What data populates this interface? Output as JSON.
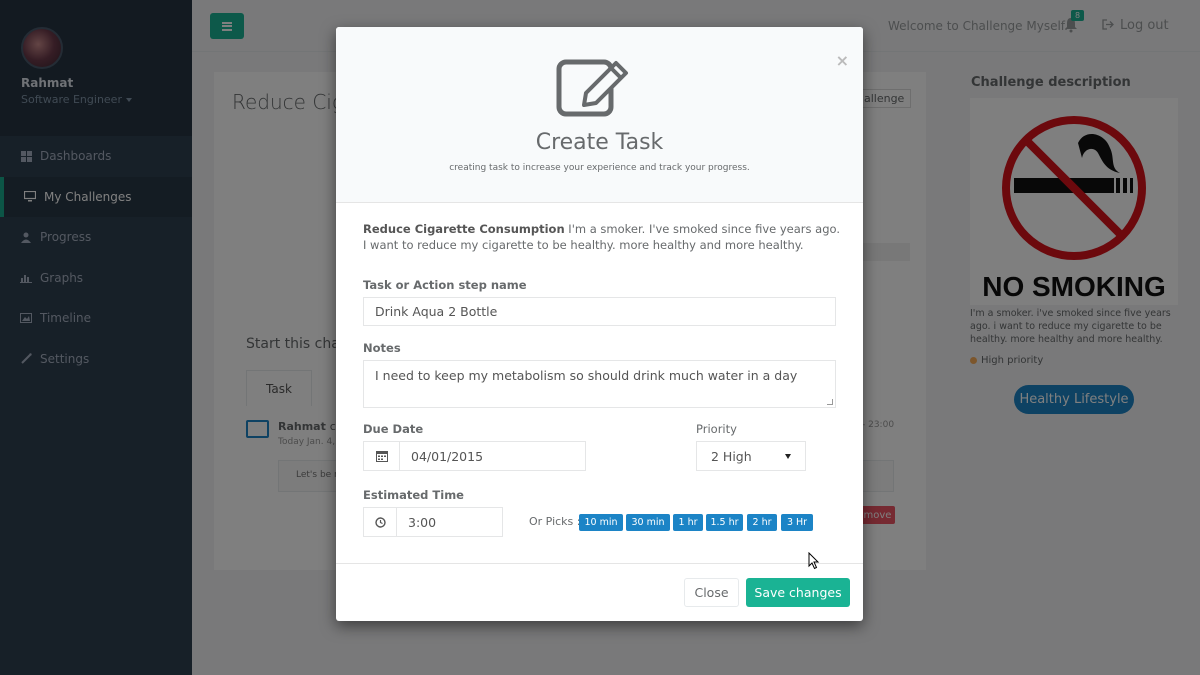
{
  "sidebar": {
    "user_name": "Rahmat",
    "user_role": "Software Engineer",
    "items": [
      {
        "label": "Dashboards",
        "icon": "dashboard-icon"
      },
      {
        "label": "My Challenges",
        "icon": "desktop-icon"
      },
      {
        "label": "Progress",
        "icon": "user-icon"
      },
      {
        "label": "Graphs",
        "icon": "bar-chart-icon"
      },
      {
        "label": "Timeline",
        "icon": "picture-icon"
      },
      {
        "label": "Settings",
        "icon": "magic-icon"
      }
    ],
    "active_index": 1
  },
  "topbar": {
    "welcome": "Welcome to Challenge Myself.",
    "notification_count": "8",
    "logout_label": "Log out"
  },
  "background": {
    "page_title": "Reduce Ciga",
    "challenge_button": "hallenge",
    "start_title": "Start this chal",
    "task_tab": "Task",
    "activity_user": "Rahmat",
    "activity_action": "cre",
    "activity_time": "Today Jan. 4, 2",
    "activity_time_right": "- 23:00",
    "comment_preview": "Let's be r",
    "remove_label": "move"
  },
  "right": {
    "title": "Challenge description",
    "image_text": "NO SMOKING",
    "description": "I'm a smoker. i've smoked since five years ago. i want to reduce my cigarette to be healthy. more healthy and more healthy.",
    "priority": "High priority",
    "tag": "Healthy Lifestyle"
  },
  "modal": {
    "title": "Create Task",
    "subtitle": "creating task to increase your experience and track your progress.",
    "challenge_name": "Reduce Cigarette Consumption",
    "challenge_desc": " I'm a smoker. I've smoked since five years ago. I want to reduce my cigarette to be healthy. more healthy and more healthy.",
    "task_label": "Task or Action step name",
    "task_value": "Drink Aqua 2 Bottle",
    "notes_label": "Notes",
    "notes_value": "I need to keep my metabolism so should drink much water in a day",
    "due_label": "Due Date",
    "due_value": "04/01/2015",
    "priority_label": "Priority",
    "priority_value": "2 High",
    "est_label": "Estimated Time",
    "est_value": "3:00",
    "or_picks": "Or Picks :",
    "picks": [
      "10 min",
      "30 min",
      "1 hr",
      "1.5 hr",
      "2 hr",
      "3 Hr"
    ],
    "close_label": "Close",
    "save_label": "Save changes"
  },
  "colors": {
    "sidebar": "#2f4050",
    "accent": "#1ab394",
    "primary": "#1c84c6",
    "danger": "#ed5565"
  }
}
